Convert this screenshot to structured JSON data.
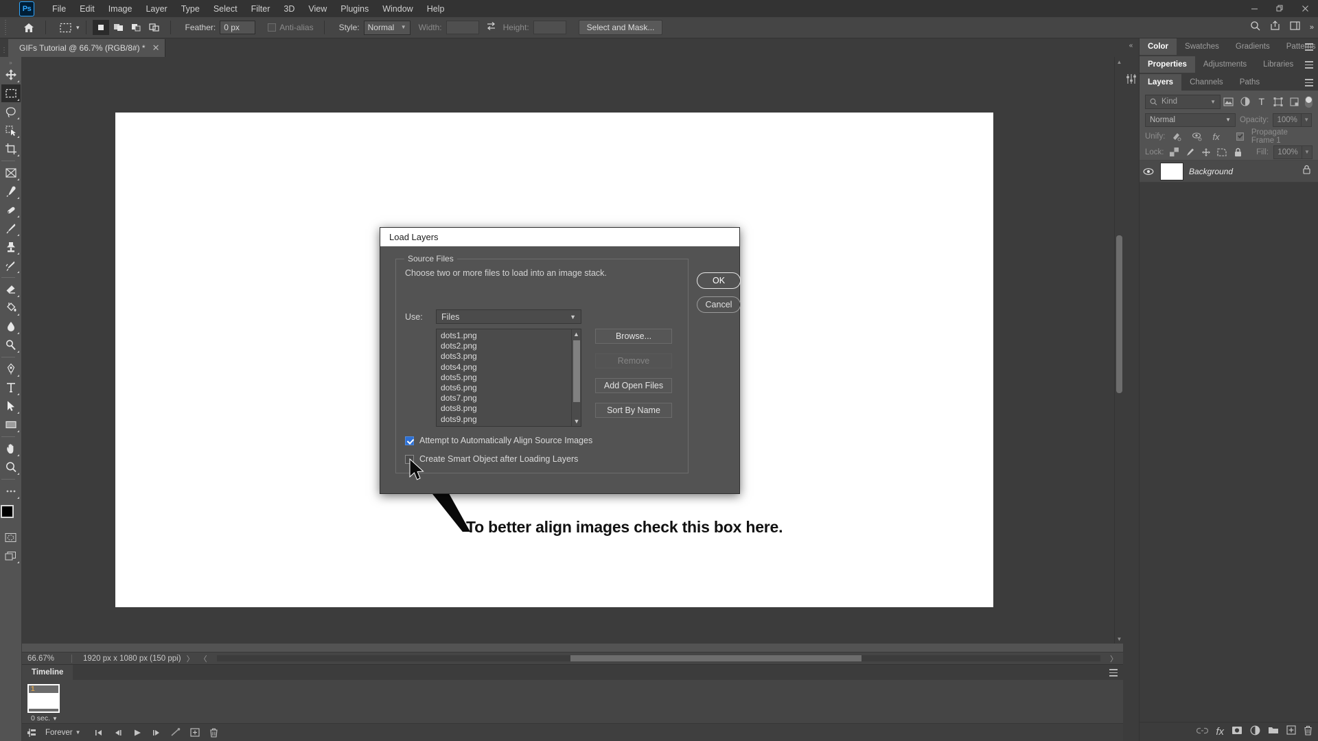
{
  "app": {
    "logo": "Ps",
    "menus": [
      "File",
      "Edit",
      "Image",
      "Layer",
      "Type",
      "Select",
      "Filter",
      "3D",
      "View",
      "Plugins",
      "Window",
      "Help"
    ],
    "window_controls": {
      "minimize": "—",
      "maximize": "❐",
      "close": "✕"
    }
  },
  "options_bar": {
    "home_icon": "home-icon",
    "tool_icon": "rectangular-marquee-icon",
    "selection_modes": [
      "new-selection",
      "add-to-selection",
      "subtract-from-selection",
      "intersect-with-selection"
    ],
    "feather_label": "Feather:",
    "feather_value": "0 px",
    "antialias_label": "Anti-alias",
    "style_label": "Style:",
    "style_value": "Normal",
    "width_label": "Width:",
    "width_value": "",
    "swap_icon": "swap-arrows-icon",
    "height_label": "Height:",
    "height_value": "",
    "select_and_mask": "Select and Mask..."
  },
  "document": {
    "tab_title": "GIFs Tutorial @ 66.7% (RGB/8#) *",
    "close_icon": "✕"
  },
  "toolbar": {
    "tools": [
      {
        "name": "move-tool",
        "icon": "move"
      },
      {
        "name": "rectangular-marquee-tool",
        "icon": "marquee",
        "active": true
      },
      {
        "name": "lasso-tool",
        "icon": "lasso"
      },
      {
        "name": "object-selection-tool",
        "icon": "object-select"
      },
      {
        "name": "crop-tool",
        "icon": "crop"
      },
      {
        "name": "frame-tool",
        "icon": "frame"
      },
      {
        "name": "eyedropper-tool",
        "icon": "eyedropper"
      },
      {
        "name": "spot-healing-brush-tool",
        "icon": "healing"
      },
      {
        "name": "brush-tool",
        "icon": "brush"
      },
      {
        "name": "clone-stamp-tool",
        "icon": "stamp"
      },
      {
        "name": "history-brush-tool",
        "icon": "history-brush"
      },
      {
        "name": "eraser-tool",
        "icon": "eraser"
      },
      {
        "name": "gradient-tool",
        "icon": "paint-bucket"
      },
      {
        "name": "blur-tool",
        "icon": "blur"
      },
      {
        "name": "dodge-tool",
        "icon": "dodge"
      },
      {
        "name": "pen-tool",
        "icon": "pen"
      },
      {
        "name": "type-tool",
        "icon": "type"
      },
      {
        "name": "path-selection-tool",
        "icon": "path-select"
      },
      {
        "name": "rectangle-tool",
        "icon": "rectangle"
      },
      {
        "name": "hand-tool",
        "icon": "hand"
      },
      {
        "name": "zoom-tool",
        "icon": "zoom"
      },
      {
        "name": "edit-toolbar",
        "icon": "ellipsis"
      }
    ],
    "quickmask_name": "quick-mask-mode",
    "screenmode_name": "screen-mode"
  },
  "status_bar": {
    "zoom": "66.67%",
    "doc_info": "1920 px x 1080 px (150 ppi)"
  },
  "timeline": {
    "tab": "Timeline",
    "frames": [
      {
        "number": "1",
        "delay": "0 sec."
      }
    ],
    "loop": "Forever",
    "buttons": [
      "tween-icon",
      "first-frame-icon",
      "previous-frame-icon",
      "play-icon",
      "next-frame-icon",
      "tween-animation-icon",
      "duplicate-frame-icon",
      "delete-frame-icon"
    ]
  },
  "right_dock": {
    "color_group": {
      "tabs": [
        "Color",
        "Swatches",
        "Gradients",
        "Patterns"
      ],
      "active": "Color"
    },
    "properties_group": {
      "tabs": [
        "Properties",
        "Adjustments",
        "Libraries"
      ],
      "active": "Properties"
    },
    "layers_group": {
      "tabs": [
        "Layers",
        "Channels",
        "Paths"
      ],
      "active": "Layers"
    },
    "layers_panel": {
      "filter_placeholder": "Kind",
      "filter_icons": [
        "pixel-filter-icon",
        "adjustment-filter-icon",
        "type-filter-icon",
        "shape-filter-icon",
        "smart-object-filter-icon"
      ],
      "blend_mode": "Normal",
      "opacity_label": "Opacity:",
      "opacity_value": "100%",
      "unify_label": "Unify:",
      "unify_icons": [
        "unify-position-icon",
        "unify-visibility-icon",
        "unify-style-icon"
      ],
      "propagate_label": "Propagate Frame 1",
      "lock_label": "Lock:",
      "lock_icons": [
        "lock-transparency-icon",
        "lock-image-icon",
        "lock-position-icon",
        "lock-artboard-icon",
        "lock-all-icon"
      ],
      "fill_label": "Fill:",
      "fill_value": "100%",
      "layers": [
        {
          "name": "Background",
          "visible": true,
          "locked": true
        }
      ],
      "footer_icons": [
        "link-layers-icon",
        "layer-style-fx-icon",
        "layer-mask-icon",
        "adjustment-layer-icon",
        "new-group-icon",
        "new-layer-icon",
        "delete-layer-icon"
      ]
    }
  },
  "dialog": {
    "title": "Load Layers",
    "group_legend": "Source Files",
    "description": "Choose two or more files to load into an image stack.",
    "use_label": "Use:",
    "use_value": "Files",
    "files": [
      "dots1.png",
      "dots2.png",
      "dots3.png",
      "dots4.png",
      "dots5.png",
      "dots6.png",
      "dots7.png",
      "dots8.png",
      "dots9.png"
    ],
    "buttons": {
      "browse": "Browse...",
      "remove": "Remove",
      "add_open_files": "Add Open Files",
      "sort_by_name": "Sort By Name",
      "ok": "OK",
      "cancel": "Cancel"
    },
    "checkboxes": [
      {
        "label": "Attempt to Automatically Align Source Images",
        "checked": true
      },
      {
        "label": "Create Smart Object after Loading Layers",
        "checked": false
      }
    ]
  },
  "annotation": {
    "text": "To better align images check this box here.",
    "arrow_name": "pointer-arrow",
    "color": "#111111"
  },
  "colors": {
    "panel_bg": "#535353",
    "dock_bg": "#3c3c3c",
    "menu_bg": "#333333",
    "accent_blue": "#2d6fd4",
    "frame_number": "#d8a14c"
  }
}
